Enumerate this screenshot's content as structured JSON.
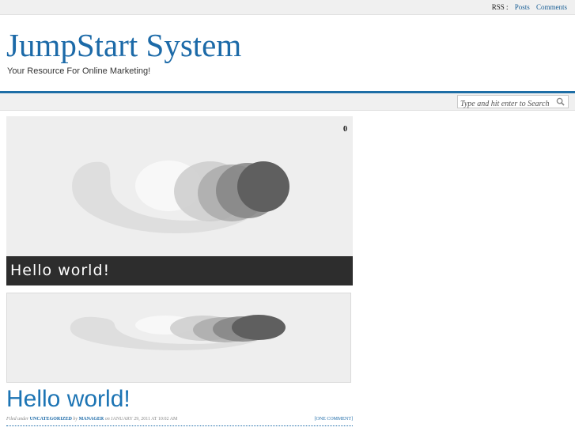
{
  "topbar": {
    "rss_label": "RSS :",
    "links": [
      "Posts",
      "Comments"
    ]
  },
  "header": {
    "title": "JumpStart System",
    "tagline": "Your Resource For Online Marketing!"
  },
  "search": {
    "placeholder": "Type and hit enter to Search",
    "icon": "search-icon"
  },
  "featured": {
    "comment_count": "0",
    "caption": "Hello world!"
  },
  "post": {
    "title": "Hello world!",
    "meta": {
      "filed_under_label": "Filed under",
      "category": "Uncategorized",
      "by_label": "by",
      "author": "manager",
      "on_label": "on",
      "date": "JANUARY 29, 2011 AT 10:02 AM",
      "comments": "[ONE COMMENT]"
    }
  },
  "colors": {
    "brand_blue": "#1c6aa8",
    "caption_bg": "#2d2d2d"
  }
}
